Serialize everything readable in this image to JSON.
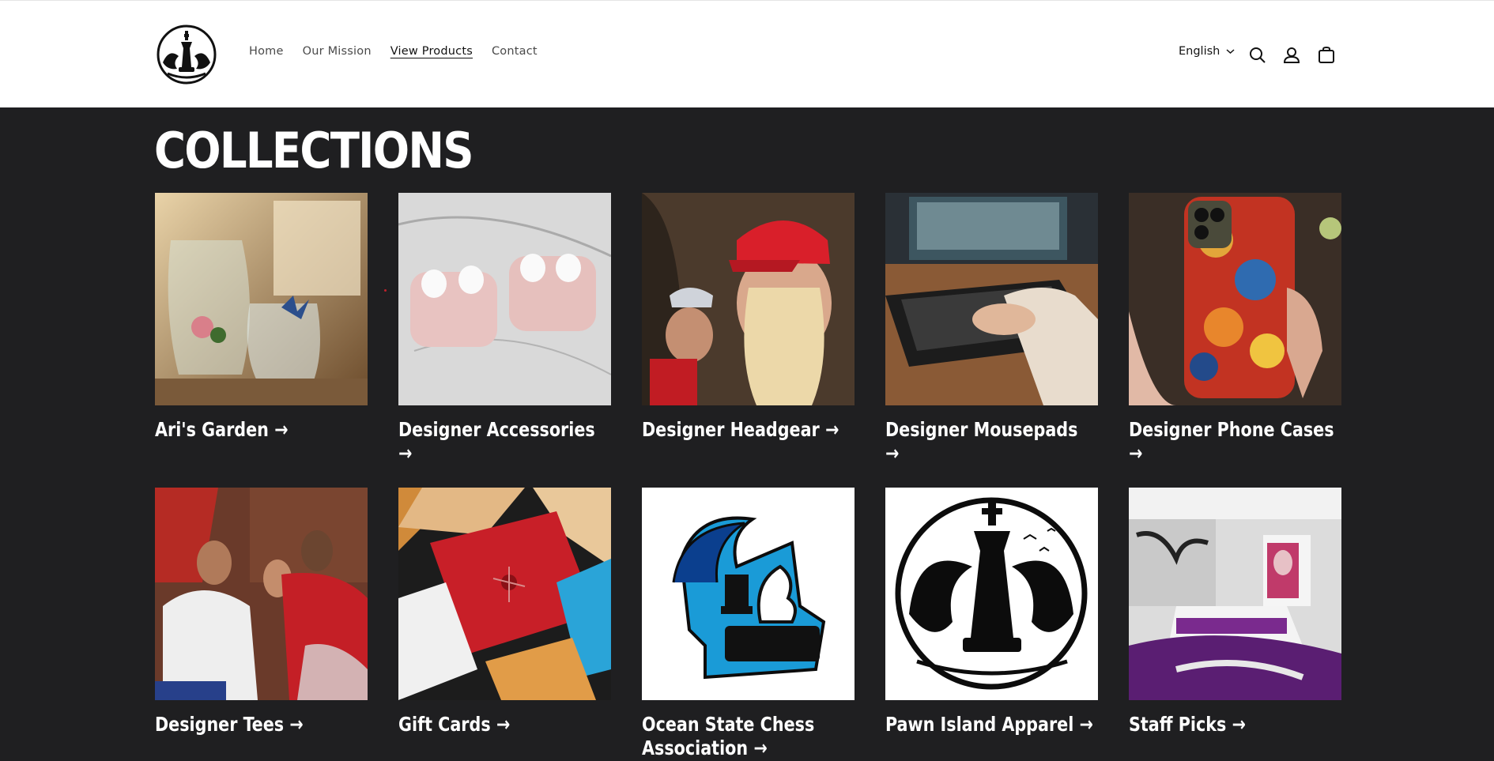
{
  "header": {
    "logo_alt": "Pawn Island",
    "nav": [
      {
        "label": "Home",
        "active": false
      },
      {
        "label": "Our Mission",
        "active": false
      },
      {
        "label": "View Products",
        "active": true
      },
      {
        "label": "Contact",
        "active": false
      }
    ],
    "language": "English",
    "icons": [
      "search-icon",
      "account-icon",
      "cart-icon"
    ]
  },
  "page": {
    "title": "COLLECTIONS"
  },
  "collections": [
    {
      "label": "Ari's Garden →",
      "image": "glass-vases-butterfly"
    },
    {
      "label": "Designer Accessories →",
      "image": "marble-earbud-cases"
    },
    {
      "label": "Designer Headgear →",
      "image": "red-cap-models"
    },
    {
      "label": "Designer Mousepads →",
      "image": "keyboard-desk"
    },
    {
      "label": "Designer Phone Cases →",
      "image": "painted-phone-case"
    },
    {
      "label": "Designer Tees →",
      "image": "group-in-tees"
    },
    {
      "label": "Gift Cards →",
      "image": "gift-cards"
    },
    {
      "label": "Ocean State Chess Association →",
      "image": "chess-wave-logo"
    },
    {
      "label": "Pawn Island Apparel →",
      "image": "king-wave-logo"
    },
    {
      "label": "Staff Picks →",
      "image": "purple-bedroom"
    }
  ],
  "colors": {
    "background": "#1f1f21",
    "header": "#ffffff",
    "text_light": "#ffffff"
  }
}
